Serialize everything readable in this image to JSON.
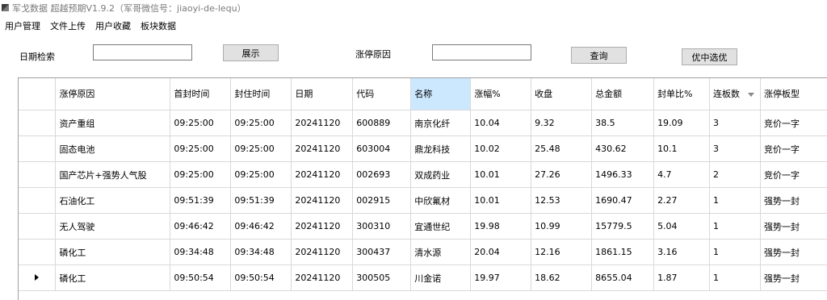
{
  "window": {
    "title": "军戈数据 超越预期V1.9.2（军哥微信号：jiaoyi-de-lequ）"
  },
  "menu": [
    "用户管理",
    "文件上传",
    "用户收藏",
    "板块数据"
  ],
  "toolbar": {
    "date_label": "日期检索",
    "date_value": "",
    "show_button": "展示",
    "reason_label": "涨停原因",
    "reason_value": "",
    "query_button": "查询",
    "select_button": "优中选优"
  },
  "table": {
    "headers": [
      "涨停原因",
      "首封时间",
      "封住时间",
      "日期",
      "代码",
      "名称",
      "涨幅%",
      "收盘",
      "总金额",
      "封单比%",
      "连板数",
      "涨停板型"
    ],
    "rows": [
      [
        "资产重组",
        "09:25:00",
        "09:25:00",
        "20241120",
        "600889",
        "南京化纤",
        "10.04",
        "9.32",
        "38.5",
        "19.09",
        "3",
        "竞价一字"
      ],
      [
        "固态电池",
        "09:25:00",
        "09:25:00",
        "20241120",
        "603004",
        "鼎龙科技",
        "10.02",
        "25.48",
        "430.62",
        "10.1",
        "3",
        "竞价一字"
      ],
      [
        "国产芯片+强势人气股",
        "09:25:00",
        "09:25:00",
        "20241120",
        "002693",
        "双成药业",
        "10.01",
        "27.26",
        "1496.33",
        "4.7",
        "2",
        "竞价一字"
      ],
      [
        "石油化工",
        "09:51:39",
        "09:51:39",
        "20241120",
        "002915",
        "中欣氟材",
        "10.01",
        "12.53",
        "1690.47",
        "2.27",
        "1",
        "强势一封"
      ],
      [
        "无人驾驶",
        "09:46:42",
        "09:46:42",
        "20241120",
        "300310",
        "宜通世纪",
        "19.98",
        "10.99",
        "15779.5",
        "5.04",
        "1",
        "强势一封"
      ],
      [
        "磷化工",
        "09:34:48",
        "09:34:48",
        "20241120",
        "300437",
        "清水源",
        "20.04",
        "12.16",
        "1861.15",
        "3.16",
        "1",
        "强势一封"
      ],
      [
        "磷化工",
        "09:50:54",
        "09:50:54",
        "20241120",
        "300505",
        "川金诺",
        "19.97",
        "18.62",
        "8655.04",
        "1.87",
        "1",
        "强势一封"
      ]
    ],
    "selected_column": 5,
    "current_row": 6
  }
}
